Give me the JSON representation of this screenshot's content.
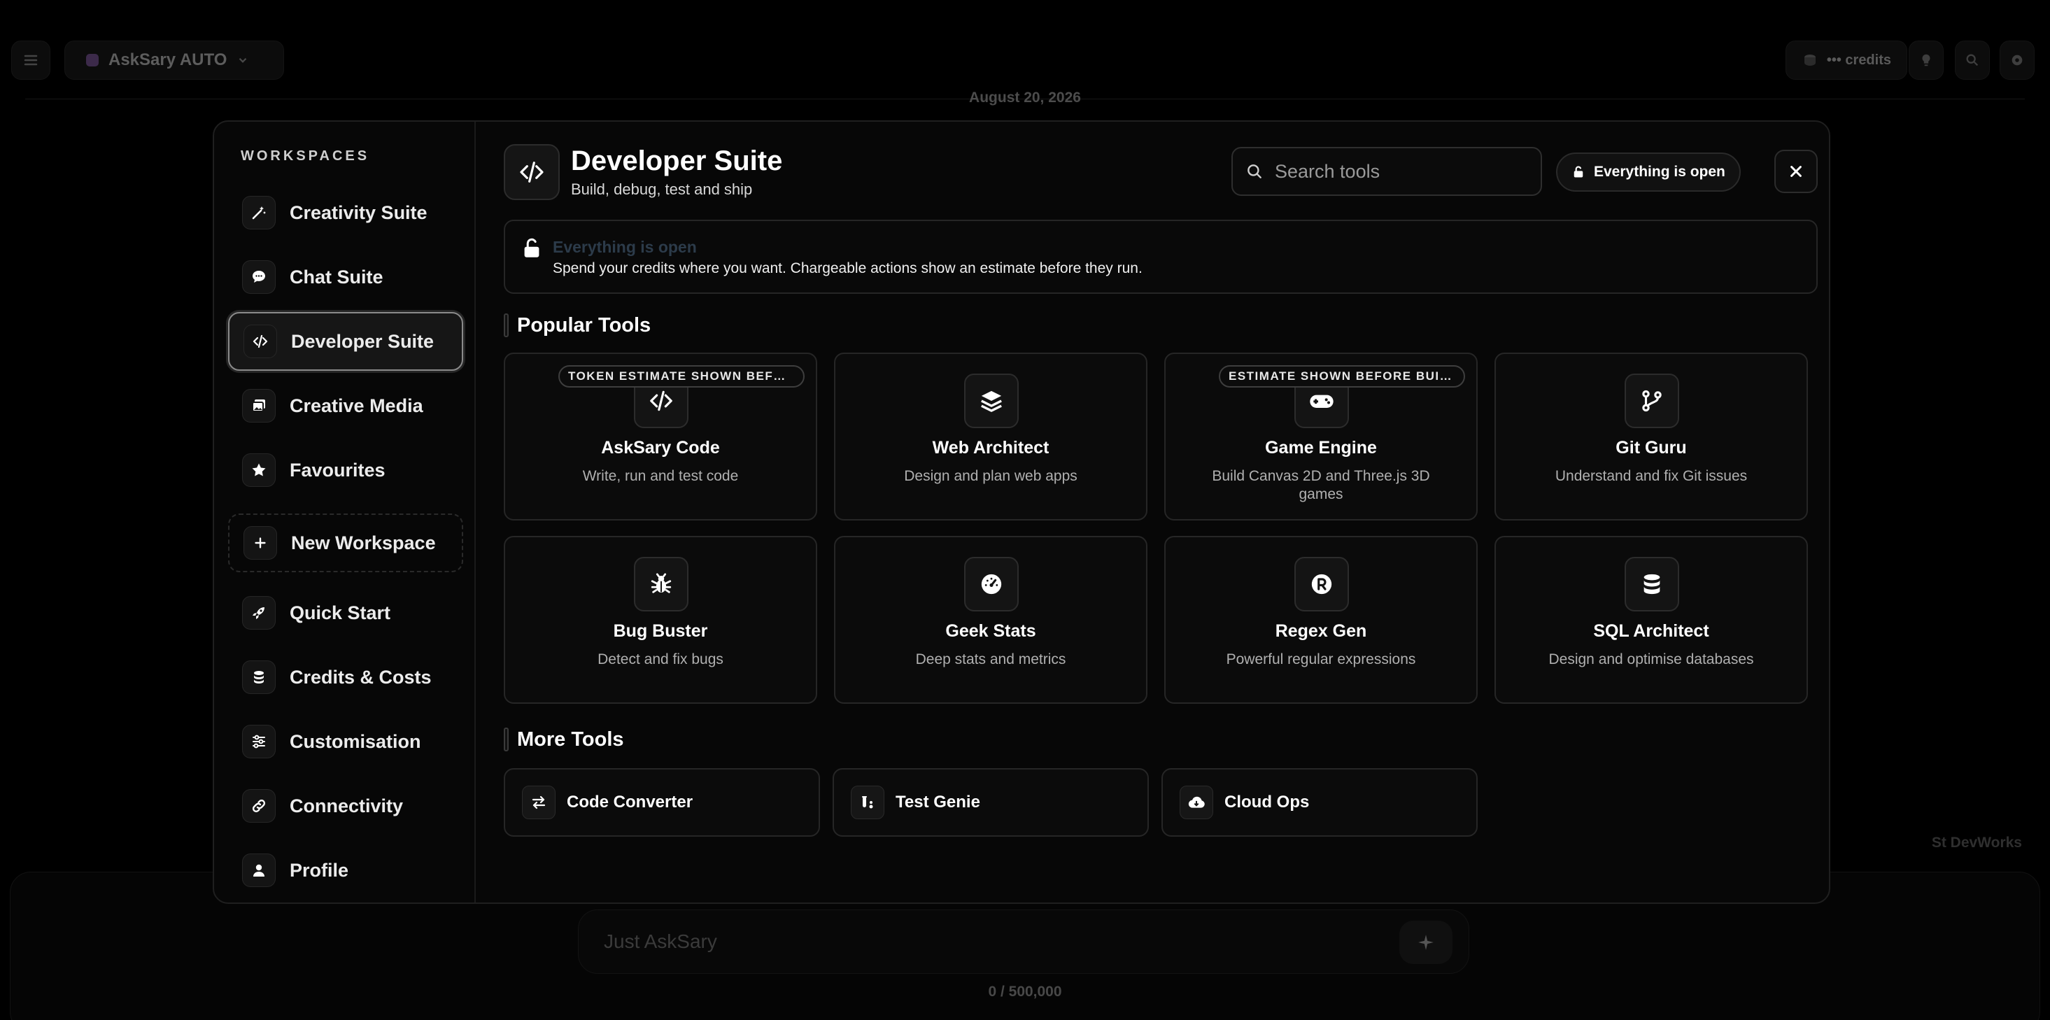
{
  "background": {
    "model_name": "AskSary AUTO",
    "credits_label": "••• credits",
    "date": "August 20, 2026",
    "signature": "St DevWorks",
    "composer_placeholder": "Just AskSary",
    "char_count": "0 / 500,000"
  },
  "sidebar": {
    "heading": "WORKSPACES",
    "items": [
      {
        "label": "Creativity Suite",
        "icon": "magic-wand-icon"
      },
      {
        "label": "Chat Suite",
        "icon": "chat-bubble-icon"
      },
      {
        "label": "Developer Suite",
        "icon": "code-icon",
        "active": true
      },
      {
        "label": "Creative Media",
        "icon": "images-icon"
      },
      {
        "label": "Favourites",
        "icon": "star-icon"
      }
    ],
    "new_workspace": "New Workspace",
    "bottom_items": [
      {
        "label": "Quick Start",
        "icon": "rocket-icon"
      },
      {
        "label": "Credits & Costs",
        "icon": "coins-icon"
      },
      {
        "label": "Customisation",
        "icon": "sliders-icon"
      },
      {
        "label": "Connectivity",
        "icon": "link-icon"
      },
      {
        "label": "Profile",
        "icon": "user-icon"
      }
    ]
  },
  "header": {
    "title": "Developer Suite",
    "subtitle": "Build, debug, test and ship",
    "search_placeholder": "Search tools",
    "open_pill": "Everything is open"
  },
  "banner": {
    "title": "Everything is open",
    "text": "Spend your credits where you want. Chargeable actions show an estimate before they run."
  },
  "popular": {
    "title": "Popular Tools",
    "tools": [
      {
        "name": "AskSary Code",
        "desc": "Write, run and test code",
        "icon": "code-icon",
        "badge": "TOKEN ESTIMATE SHOWN BEFO..."
      },
      {
        "name": "Web Architect",
        "desc": "Design and plan web apps",
        "icon": "layers-icon",
        "badge": ""
      },
      {
        "name": "Game Engine",
        "desc": "Build Canvas 2D and Three.js 3D games",
        "icon": "gamepad-icon",
        "badge": "ESTIMATE SHOWN BEFORE BUILD"
      },
      {
        "name": "Git Guru",
        "desc": "Understand and fix Git issues",
        "icon": "git-branch-icon",
        "badge": ""
      },
      {
        "name": "Bug Buster",
        "desc": "Detect and fix bugs",
        "icon": "bug-icon",
        "badge": ""
      },
      {
        "name": "Geek Stats",
        "desc": "Deep stats and metrics",
        "icon": "gauge-icon",
        "badge": ""
      },
      {
        "name": "Regex Gen",
        "desc": "Powerful regular expressions",
        "icon": "registered-icon",
        "badge": ""
      },
      {
        "name": "SQL Architect",
        "desc": "Design and optimise databases",
        "icon": "database-icon",
        "badge": ""
      }
    ]
  },
  "more": {
    "title": "More Tools",
    "tools": [
      {
        "name": "Code Converter",
        "icon": "swap-arrows-icon"
      },
      {
        "name": "Test Genie",
        "icon": "flask-icon"
      },
      {
        "name": "Cloud Ops",
        "icon": "cloud-icon"
      }
    ]
  }
}
